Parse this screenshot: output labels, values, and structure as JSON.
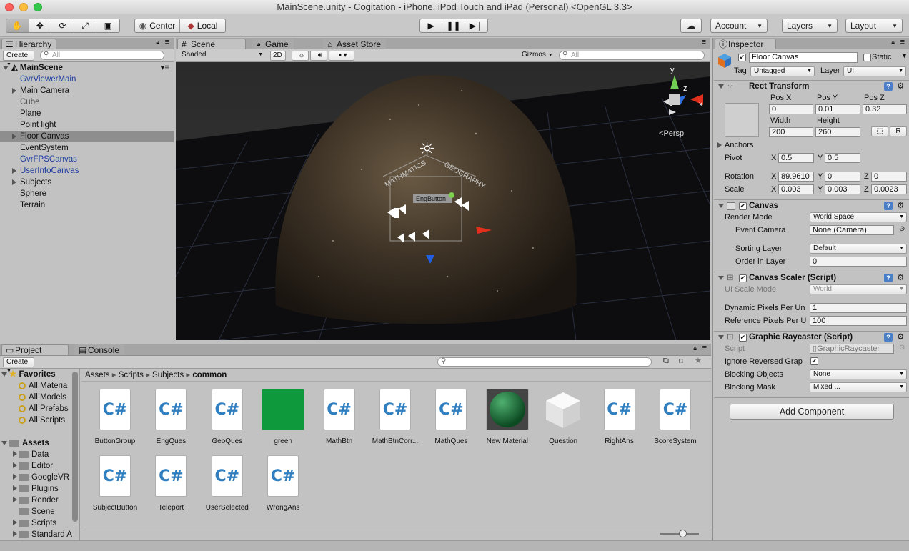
{
  "window": {
    "title": "MainScene.unity - Cogitation - iPhone, iPod Touch and iPad (Personal) <OpenGL 3.3>"
  },
  "toolbar": {
    "pivot_label": "Center",
    "space_label": "Local",
    "account_label": "Account",
    "layers_label": "Layers",
    "layout_label": "Layout",
    "play_icon": "play-icon",
    "pause_icon": "pause-icon",
    "step_icon": "step-icon"
  },
  "hierarchy": {
    "tab": "Hierarchy",
    "create": "Create",
    "search_placeholder": "All",
    "scene": "MainScene",
    "items": [
      {
        "label": "GvrViewerMain",
        "prefab": true
      },
      {
        "label": "Main Camera",
        "expandable": true
      },
      {
        "label": "Cube",
        "inactive": true
      },
      {
        "label": "Plane"
      },
      {
        "label": "Point light"
      },
      {
        "label": "Floor Canvas",
        "expandable": true,
        "selected": true
      },
      {
        "label": "EventSystem"
      },
      {
        "label": "GvrFPSCanvas",
        "prefab": true
      },
      {
        "label": "UserInfoCanvas",
        "expandable": true,
        "prefab": true
      },
      {
        "label": "Subjects",
        "expandable": true
      },
      {
        "label": "Sphere"
      },
      {
        "label": "Terrain"
      }
    ]
  },
  "scene": {
    "tab_scene": "Scene",
    "tab_game": "Game",
    "tab_store": "Asset Store",
    "shading": "Shaded",
    "mode_2d": "2D",
    "gizmos": "Gizmos",
    "search_placeholder": "All",
    "persp": "Persp",
    "axis_y": "y",
    "axis_z": "z",
    "axis_x": "x",
    "label_math": "MATHMATICS",
    "label_geo": "GEOGRAPHY",
    "label_eng": "EngButton"
  },
  "project": {
    "tab_project": "Project",
    "tab_console": "Console",
    "create": "Create",
    "favorites_label": "Favorites",
    "favorites": [
      "All Materia",
      "All Models",
      "All Prefabs",
      "All Scripts"
    ],
    "assets_label": "Assets",
    "folders": [
      "Data",
      "Editor",
      "GoogleVR",
      "Plugins",
      "Render",
      "Scene",
      "Scripts",
      "Standard A"
    ],
    "breadcrumb": [
      "Assets",
      "Scripts",
      "Subjects",
      "common"
    ],
    "assets": [
      {
        "name": "ButtonGroup",
        "kind": "script"
      },
      {
        "name": "EngQues",
        "kind": "script"
      },
      {
        "name": "GeoQues",
        "kind": "script"
      },
      {
        "name": "green",
        "kind": "material-green"
      },
      {
        "name": "MathBtn",
        "kind": "script"
      },
      {
        "name": "MathBtnCorr...",
        "kind": "script"
      },
      {
        "name": "MathQues",
        "kind": "script"
      },
      {
        "name": "New Material",
        "kind": "material-sphere"
      },
      {
        "name": "Question",
        "kind": "cube"
      },
      {
        "name": "RightAns",
        "kind": "script"
      },
      {
        "name": "ScoreSystem",
        "kind": "script"
      },
      {
        "name": "SubjectButton",
        "kind": "script"
      },
      {
        "name": "Teleport",
        "kind": "script"
      },
      {
        "name": "UserSelected",
        "kind": "script"
      },
      {
        "name": "WrongAns",
        "kind": "script"
      }
    ]
  },
  "inspector": {
    "tab": "Inspector",
    "object_name": "Floor Canvas",
    "static_label": "Static",
    "tag_label": "Tag",
    "tag_value": "Untagged",
    "layer_label": "Layer",
    "layer_value": "UI",
    "rect": {
      "title": "Rect Transform",
      "pos_x_label": "Pos X",
      "pos_y_label": "Pos Y",
      "pos_z_label": "Pos Z",
      "pos_x": "0",
      "pos_y": "0.01",
      "pos_z": "0.32",
      "width_label": "Width",
      "height_label": "Height",
      "width": "200",
      "height": "260",
      "r_btn": "R",
      "anchors": "Anchors",
      "pivot": "Pivot",
      "pivot_x": "0.5",
      "pivot_y": "0.5",
      "rotation": "Rotation",
      "rot_x": "89.9610",
      "rot_y": "0",
      "rot_z": "0",
      "scale": "Scale",
      "scale_x": "0.003",
      "scale_y": "0.003",
      "scale_z": "0.0023",
      "x": "X",
      "y": "Y",
      "z": "Z"
    },
    "canvas": {
      "title": "Canvas",
      "render_mode_label": "Render Mode",
      "render_mode": "World Space",
      "event_camera_label": "Event Camera",
      "event_camera": "None (Camera)",
      "sorting_layer_label": "Sorting Layer",
      "sorting_layer": "Default",
      "order_label": "Order in Layer",
      "order": "0"
    },
    "scaler": {
      "title": "Canvas Scaler (Script)",
      "ui_scale_label": "UI Scale Mode",
      "ui_scale": "World",
      "dpu_label": "Dynamic Pixels Per Un",
      "dpu": "1",
      "rpu_label": "Reference Pixels Per U",
      "rpu": "100"
    },
    "raycaster": {
      "title": "Graphic Raycaster (Script)",
      "script_label": "Script",
      "script": "GraphicRaycaster",
      "ignore_label": "Ignore Reversed Grap",
      "blocking_objects_label": "Blocking Objects",
      "blocking_objects": "None",
      "blocking_mask_label": "Blocking Mask",
      "blocking_mask": "Mixed ..."
    },
    "add_component": "Add Component"
  }
}
